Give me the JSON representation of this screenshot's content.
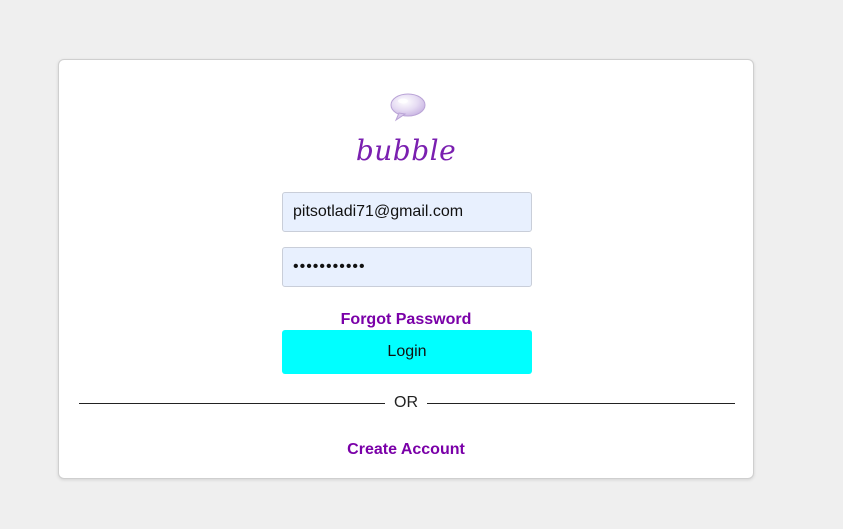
{
  "brand": {
    "name": "bubble",
    "icon": "speech-bubble-icon",
    "color": "#7a1fb0"
  },
  "form": {
    "email_value": "pitsotladi71@gmail.com",
    "password_masked": "•••••••••••",
    "forgot_label": "Forgot Password",
    "login_label": "Login",
    "or_label": "OR",
    "create_label": "Create Account"
  },
  "colors": {
    "accent_link": "#7a00a8",
    "login_button": "#00ffff",
    "input_bg": "#e8f0fe"
  }
}
